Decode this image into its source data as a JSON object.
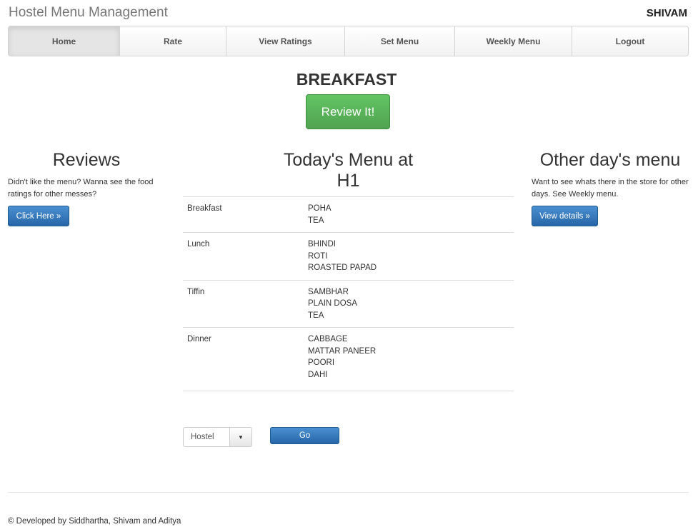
{
  "header": {
    "brand": "Hostel Menu Management",
    "username": "SHIVAM"
  },
  "nav": {
    "items": [
      {
        "label": "Home",
        "active": true
      },
      {
        "label": "Rate",
        "active": false
      },
      {
        "label": "View Ratings",
        "active": false
      },
      {
        "label": "Set Menu",
        "active": false
      },
      {
        "label": "Weekly Menu",
        "active": false
      },
      {
        "label": "Logout",
        "active": false
      }
    ]
  },
  "current": {
    "meal": "BREAKFAST",
    "review_label": "Review It!"
  },
  "reviews": {
    "title": "Reviews",
    "text": "Didn't like the menu? Wanna see the food ratings for other messes?",
    "button": "Click Here »"
  },
  "today": {
    "title_line1": "Today's Menu at",
    "title_line2": "H1",
    "rows": [
      {
        "meal": "Breakfast",
        "items": [
          "POHA",
          "TEA"
        ]
      },
      {
        "meal": "Lunch",
        "items": [
          "BHINDI",
          "ROTI",
          "ROASTED PAPAD"
        ]
      },
      {
        "meal": "Tiffin",
        "items": [
          "SAMBHAR",
          "PLAIN DOSA",
          "TEA"
        ]
      },
      {
        "meal": "Dinner",
        "items": [
          "CABBAGE",
          "MATTAR PANEER",
          "POORI",
          "DAHI"
        ]
      }
    ]
  },
  "other": {
    "title": "Other day's menu",
    "text": "Want to see whats there in the store for other days. See Weekly menu.",
    "button": "View details »"
  },
  "selector": {
    "value": "Hostel",
    "go_label": "Go"
  },
  "footer": {
    "text": "© Developed by Siddhartha, Shivam and Aditya"
  },
  "colors": {
    "success": "#5cb85c",
    "primary": "#337ab7"
  }
}
